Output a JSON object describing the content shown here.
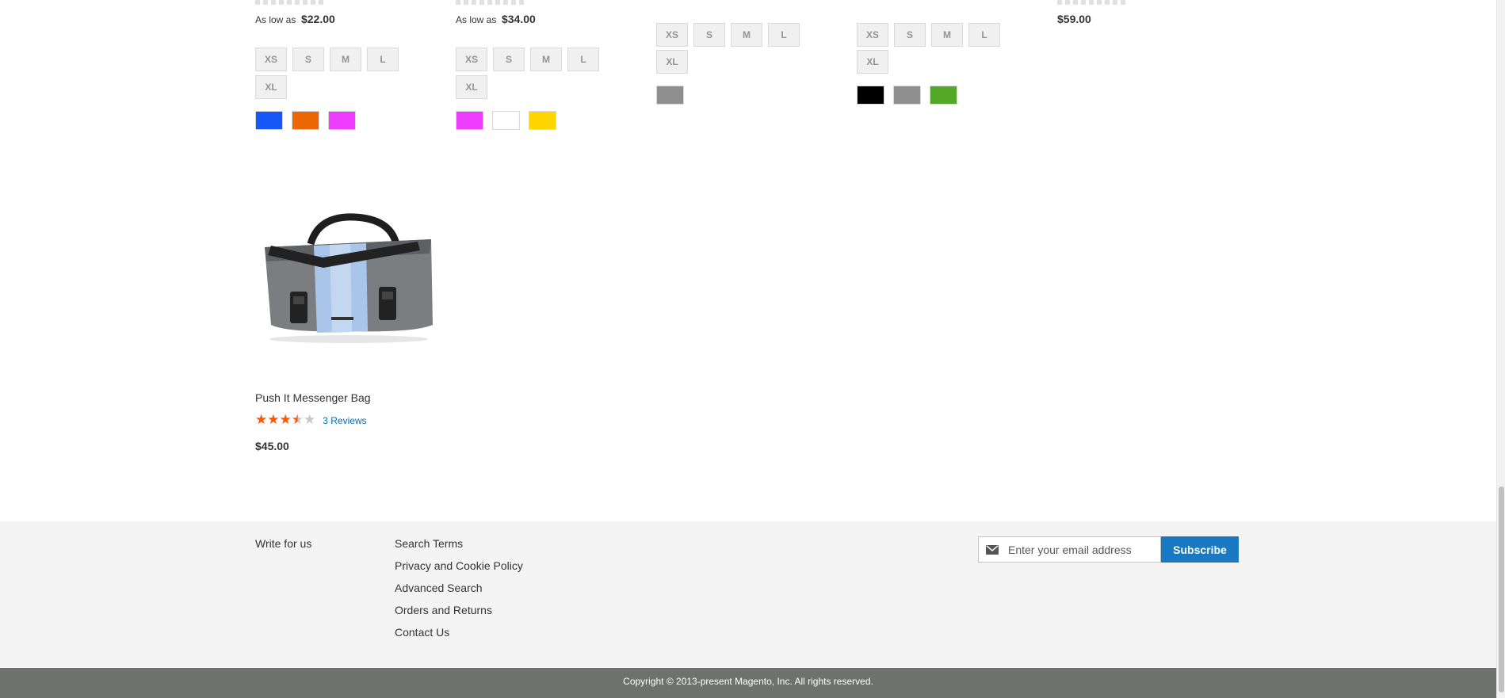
{
  "products_top": [
    {
      "price_label": "As low as",
      "price": "$22.00",
      "sizes": [
        "XS",
        "S",
        "M",
        "L",
        "XL"
      ],
      "swatches": [
        "#1857f7",
        "#eb6703",
        "#ef3dff"
      ]
    },
    {
      "price_label": "As low as",
      "price": "$34.00",
      "sizes": [
        "XS",
        "S",
        "M",
        "L",
        "XL"
      ],
      "swatches": [
        "#ef3dff",
        "#ffffff",
        "#ffd500"
      ]
    },
    {
      "sizes": [
        "XS",
        "S",
        "M",
        "L",
        "XL"
      ],
      "swatches": [
        "#8f8f8f"
      ]
    },
    {
      "sizes": [
        "XS",
        "S",
        "M",
        "L",
        "XL"
      ],
      "swatches": [
        "#000000",
        "#8f8f8f",
        "#53a828"
      ]
    },
    {
      "price": "$59.00"
    }
  ],
  "featured_product": {
    "name": "Push It Messenger Bag",
    "rating": 3.5,
    "rating_max": 5,
    "reviews_label": "3 Reviews",
    "price": "$45.00"
  },
  "footer": {
    "links_col1": [
      "Write for us"
    ],
    "links_col2": [
      "Search Terms",
      "Privacy and Cookie Policy",
      "Advanced Search",
      "Orders and Returns",
      "Contact Us"
    ],
    "newsletter": {
      "icon": "envelope-icon",
      "placeholder": "Enter your email address",
      "button_label": "Subscribe"
    },
    "copyright": "Copyright © 2013-present Magento, Inc. All rights reserved."
  },
  "colors": {
    "accent": "#1979c3",
    "rating": "#ff5501",
    "footer_bg": "#f4f4f4",
    "copyright_bg": "#6e716e"
  }
}
